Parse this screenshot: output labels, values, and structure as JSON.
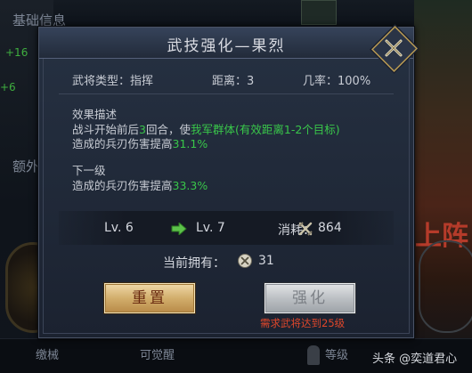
{
  "background": {
    "left_title": "基础信息",
    "left_values": [
      "+16",
      "+6"
    ],
    "left_label": "额外",
    "right_text": "上阵",
    "bottom_items": [
      "缴械",
      "可觉醒",
      "等级"
    ]
  },
  "dialog": {
    "title": "武技强化—果烈",
    "info": {
      "type_label": "武将类型：",
      "type_value": "指挥",
      "range_label": "距离：",
      "range_value": "3",
      "rate_label": "几率：",
      "rate_value": "100%"
    },
    "effect": {
      "heading": "效果描述",
      "line1_pre": "战斗开始前后",
      "line1_num": "3",
      "line1_mid": "回合，使",
      "line1_green": "我军群体(有效距离1-2个目标)",
      "line2_pre": "造成的兵刃伤害提高",
      "line2_value": "31.1%"
    },
    "next": {
      "heading": "下一级",
      "line_pre": "造成的兵刃伤害提高",
      "line_value": "33.3%"
    },
    "level": {
      "current": "Lv. 6",
      "next": "Lv. 7",
      "cost_label": "消耗：",
      "cost_value": "864"
    },
    "owned": {
      "label": "当前拥有：",
      "value": "31"
    },
    "buttons": {
      "reset": "重置",
      "enhance": "强化"
    },
    "requirement": "需求武将达到25级"
  },
  "watermark": "头条 @奕道君心",
  "colors": {
    "highlight_green": "#39c64a",
    "warning_red": "#e0472b",
    "reset_button": "#d2ae6c",
    "enhance_button_disabled": "#bcc0c4"
  },
  "icons": [
    "close-x-icon",
    "arrow-right-icon",
    "crossed-swords-token-icon",
    "coin-token-icon"
  ]
}
